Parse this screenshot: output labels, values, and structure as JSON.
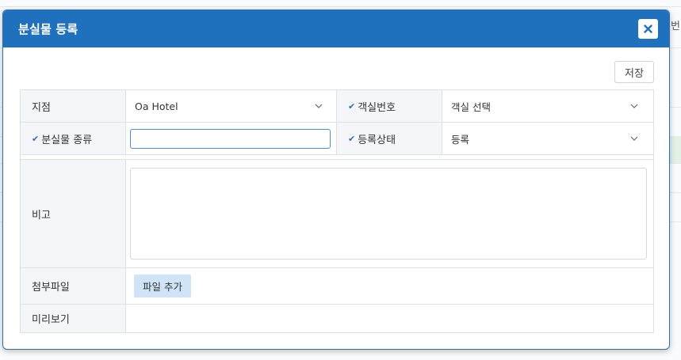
{
  "background": {
    "corner_text": "번"
  },
  "modal": {
    "title": "분실물 등록",
    "close_label": "×",
    "save_label": "저장",
    "fields": {
      "branch": {
        "label": "지점",
        "value": "Oa Hotel"
      },
      "room_number": {
        "label": "객실번호",
        "placeholder": "객실 선택",
        "required": true
      },
      "lost_item_type": {
        "label": "분실물 종류",
        "value": "",
        "required": true
      },
      "register_status": {
        "label": "등록상태",
        "value": "등록",
        "required": true
      },
      "note": {
        "label": "비고",
        "value": ""
      },
      "attachment": {
        "label": "첨부파일",
        "button_label": "파일 추가"
      },
      "preview": {
        "label": "미리보기"
      }
    }
  },
  "colors": {
    "header": "#2071bd",
    "label_bg": "#f4f6f9",
    "file_button_bg": "#cfe4f7",
    "check_icon": "#2e6fb4"
  }
}
